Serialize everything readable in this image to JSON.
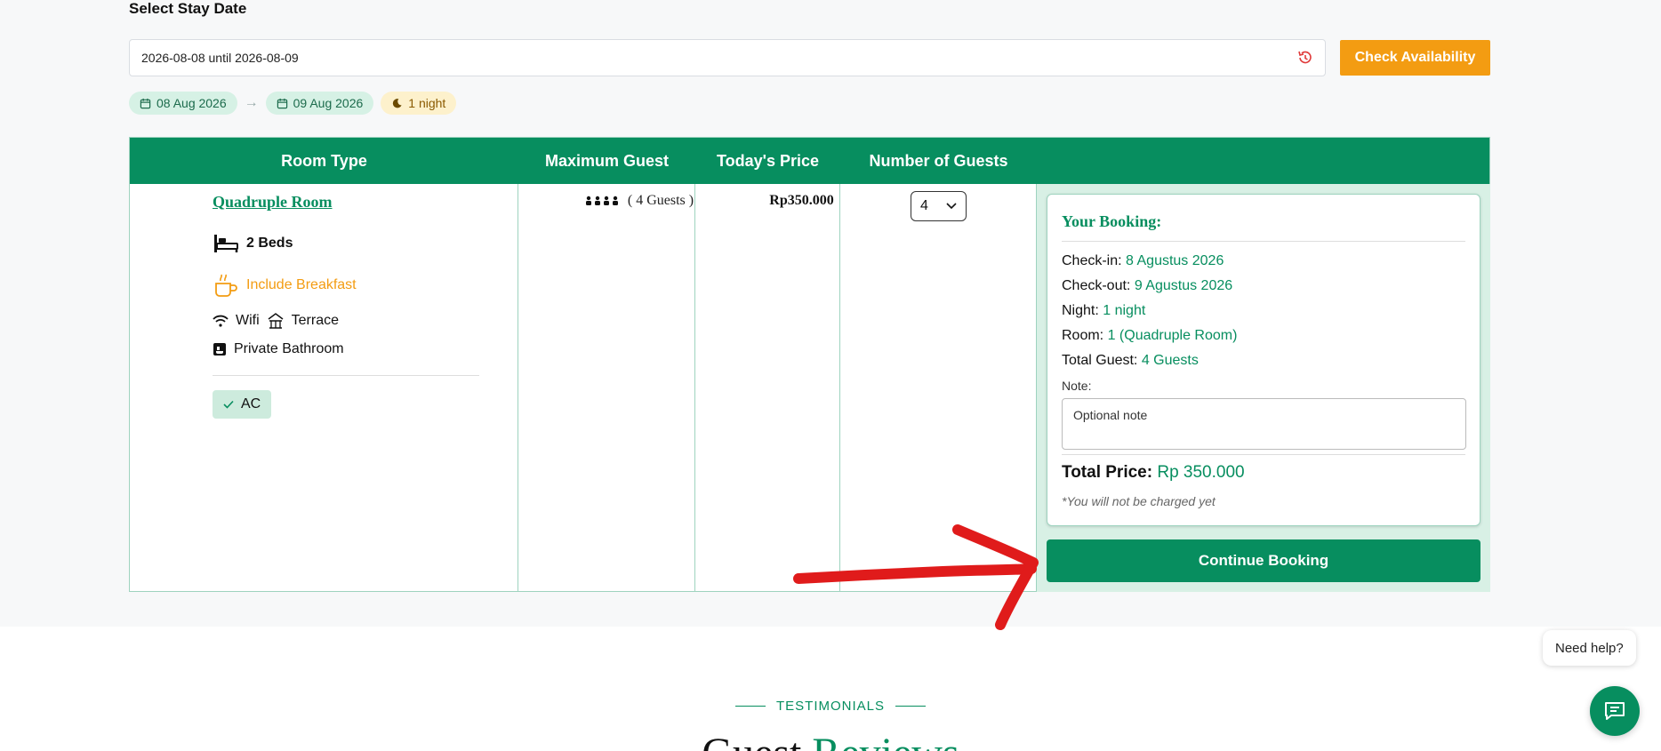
{
  "stay": {
    "title": "Select Stay Date",
    "date_range_value": "2026-08-08 until 2026-08-09",
    "check_button": "Check Availability",
    "chip_checkin": "08 Aug 2026",
    "chip_arrow": "→",
    "chip_checkout": "09 Aug 2026",
    "chip_nights": "1 night"
  },
  "table": {
    "headers": [
      "Room Type",
      "Maximum Guest",
      "Today's Price",
      "Number of Guests",
      ""
    ],
    "room": {
      "name": "Quadruple Room",
      "beds": "2 Beds",
      "breakfast": "Include Breakfast",
      "wifi": "Wifi",
      "terrace": "Terrace",
      "bathroom": "Private Bathroom",
      "ac": "AC",
      "max_guest": "( 4 Guests )",
      "price": "Rp350.000",
      "guests_selected": "4"
    }
  },
  "booking": {
    "title": "Your Booking:",
    "checkin_label": "Check-in:",
    "checkin_value": "8 Agustus 2026",
    "checkout_label": "Check-out:",
    "checkout_value": "9 Agustus 2026",
    "night_label": "Night:",
    "night_value": "1 night",
    "room_label": "Room:",
    "room_value": "1 (Quadruple Room)",
    "guest_label": "Total Guest:",
    "guest_value": "4 Guests",
    "note_label": "Note:",
    "note_placeholder": "Optional note",
    "total_label": "Total Price:",
    "total_value": "Rp 350.000",
    "charge_note": "*You will not be charged yet",
    "continue_button": "Continue Booking"
  },
  "testimonials": {
    "eyebrow": "TESTIMONIALS",
    "heading_a": "Guest",
    "heading_b": "Reviews"
  },
  "help": {
    "bubble": "Need help?"
  },
  "colors": {
    "brand_green": "#078e5f",
    "accent_orange": "#f39c12",
    "annotation_red": "#e01b1b"
  }
}
